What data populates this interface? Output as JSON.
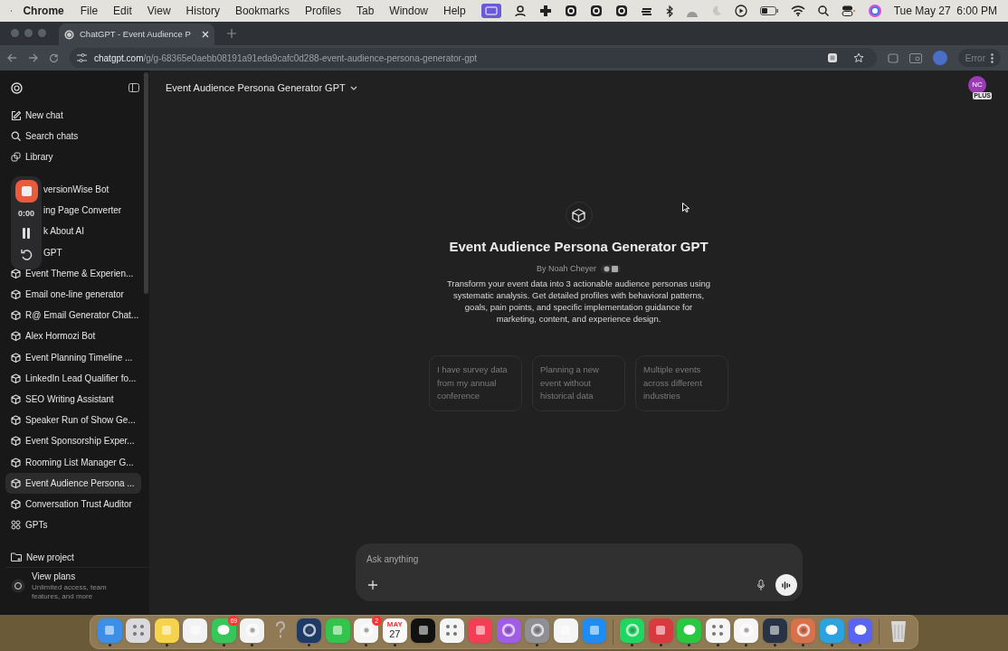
{
  "menu_bar": {
    "app": "Chrome",
    "menus": [
      "File",
      "Edit",
      "View",
      "History",
      "Bookmarks",
      "Profiles",
      "Tab",
      "Window",
      "Help"
    ],
    "clock": "Tue May 27  6:00 PM"
  },
  "browser": {
    "tab_title": "ChatGPT - Event Audience P",
    "url_host": "chatgpt.com",
    "url_path": "/g/g-68365e0aebb08191a91eda9cafc0d288-event-audience-persona-generator-gpt",
    "profile_status": "Error"
  },
  "sidebar": {
    "nav": [
      {
        "label": "New chat",
        "kind": "new"
      },
      {
        "label": "Search chats",
        "kind": "search"
      },
      {
        "label": "Library",
        "kind": "library"
      }
    ],
    "gpts": [
      {
        "label": "versionWise Bot",
        "kind": "covered",
        "selected": false
      },
      {
        "label": "ing Page Converter",
        "kind": "covered",
        "selected": false
      },
      {
        "label": "k About AI",
        "kind": "covered",
        "selected": false
      },
      {
        "label": "GPT",
        "kind": "covered",
        "selected": false
      },
      {
        "label": "Event Theme & Experien...",
        "kind": "gpt",
        "selected": false
      },
      {
        "label": "Email one-line generator",
        "kind": "gpt",
        "selected": false
      },
      {
        "label": "R@ Email Generator Chat...",
        "kind": "gpt",
        "selected": false
      },
      {
        "label": "Alex Hormozi Bot",
        "kind": "gpt",
        "selected": false
      },
      {
        "label": "Event Planning Timeline ...",
        "kind": "gpt",
        "selected": false
      },
      {
        "label": "LinkedIn Lead Qualifier fo...",
        "kind": "gpt",
        "selected": false
      },
      {
        "label": "SEO Writing Assistant",
        "kind": "gpt",
        "selected": false
      },
      {
        "label": "Speaker Run of Show Ge...",
        "kind": "gpt",
        "selected": false
      },
      {
        "label": "Event Sponsorship Exper...",
        "kind": "gpt",
        "selected": false
      },
      {
        "label": "Rooming List Manager G...",
        "kind": "gpt",
        "selected": false
      },
      {
        "label": "Event Audience Persona ...",
        "kind": "gpt",
        "selected": true
      },
      {
        "label": "Conversation Trust Auditor",
        "kind": "gpt",
        "selected": false
      },
      {
        "label": "GPTs",
        "kind": "explore",
        "selected": false
      }
    ],
    "new_project": "New project",
    "plans": {
      "title": "View plans",
      "subtitle": "Unlimited access, team features, and more"
    }
  },
  "recorder": {
    "time": "0:00"
  },
  "header": {
    "title": "Event Audience Persona Generator GPT",
    "avatar": "NC",
    "avatar_badge": "PLUS"
  },
  "gpt": {
    "name": "Event Audience Persona Generator GPT",
    "author": "By Noah Cheyer",
    "description": "Transform your event data into 3 actionable audience personas using systematic analysis. Get detailed profiles with behavioral patterns, goals, pain points, and specific implementation guidance for marketing, content, and experience design."
  },
  "starters": [
    "I have survey data from my annual conference",
    "Planning a new event without historical data",
    "Multiple events across different industries"
  ],
  "composer": {
    "placeholder": "Ask anything"
  },
  "dock": [
    {
      "kind": "app",
      "color": "#3b8fe8",
      "running": true
    },
    {
      "kind": "grid",
      "color": "#d9d9de",
      "running": false
    },
    {
      "kind": "app",
      "color": "#f5d34a",
      "running": true
    },
    {
      "kind": "app",
      "color": "#f2f2f2",
      "running": false
    },
    {
      "kind": "bubble",
      "color": "#35c759",
      "running": true,
      "badge": "69"
    },
    {
      "kind": "ring",
      "color": "#f2f2f2",
      "running": true
    },
    {
      "kind": "question",
      "color": "#b9b4aa",
      "running": false
    },
    {
      "kind": "ring",
      "color": "#1d3b66",
      "running": true
    },
    {
      "kind": "app",
      "color": "#33c44e",
      "running": false
    },
    {
      "kind": "ring",
      "color": "#f5f5f5",
      "running": true,
      "badge": "2"
    },
    {
      "kind": "calendar",
      "color": "#fafafa",
      "running": true,
      "month": "MAY",
      "day": "27"
    },
    {
      "kind": "app",
      "color": "#111111",
      "running": false
    },
    {
      "kind": "grid",
      "color": "#f5f5f5",
      "running": false
    },
    {
      "kind": "app",
      "color": "#f53d55",
      "running": false
    },
    {
      "kind": "ring",
      "color": "#a05ee8",
      "running": false
    },
    {
      "kind": "ring",
      "color": "#8e8e93",
      "running": true
    },
    {
      "kind": "app",
      "color": "#f5f5f5",
      "running": false
    },
    {
      "kind": "app",
      "color": "#1e8cf5",
      "running": false
    },
    {
      "kind": "separator"
    },
    {
      "kind": "ring",
      "color": "#1ed760",
      "running": true
    },
    {
      "kind": "app",
      "color": "#da3940",
      "running": true
    },
    {
      "kind": "bubble",
      "color": "#28c840",
      "running": true
    },
    {
      "kind": "grid",
      "color": "#f5f5f5",
      "running": true
    },
    {
      "kind": "ring",
      "color": "#f5f5f5",
      "running": true
    },
    {
      "kind": "app",
      "color": "#283347",
      "running": true
    },
    {
      "kind": "ring",
      "color": "#d9704c",
      "running": true
    },
    {
      "kind": "bubble",
      "color": "#2aa3e0",
      "running": true
    },
    {
      "kind": "bubble",
      "color": "#5865f2",
      "running": true
    },
    {
      "kind": "separator"
    },
    {
      "kind": "trash",
      "color": "#d8d8d8",
      "running": false
    }
  ]
}
